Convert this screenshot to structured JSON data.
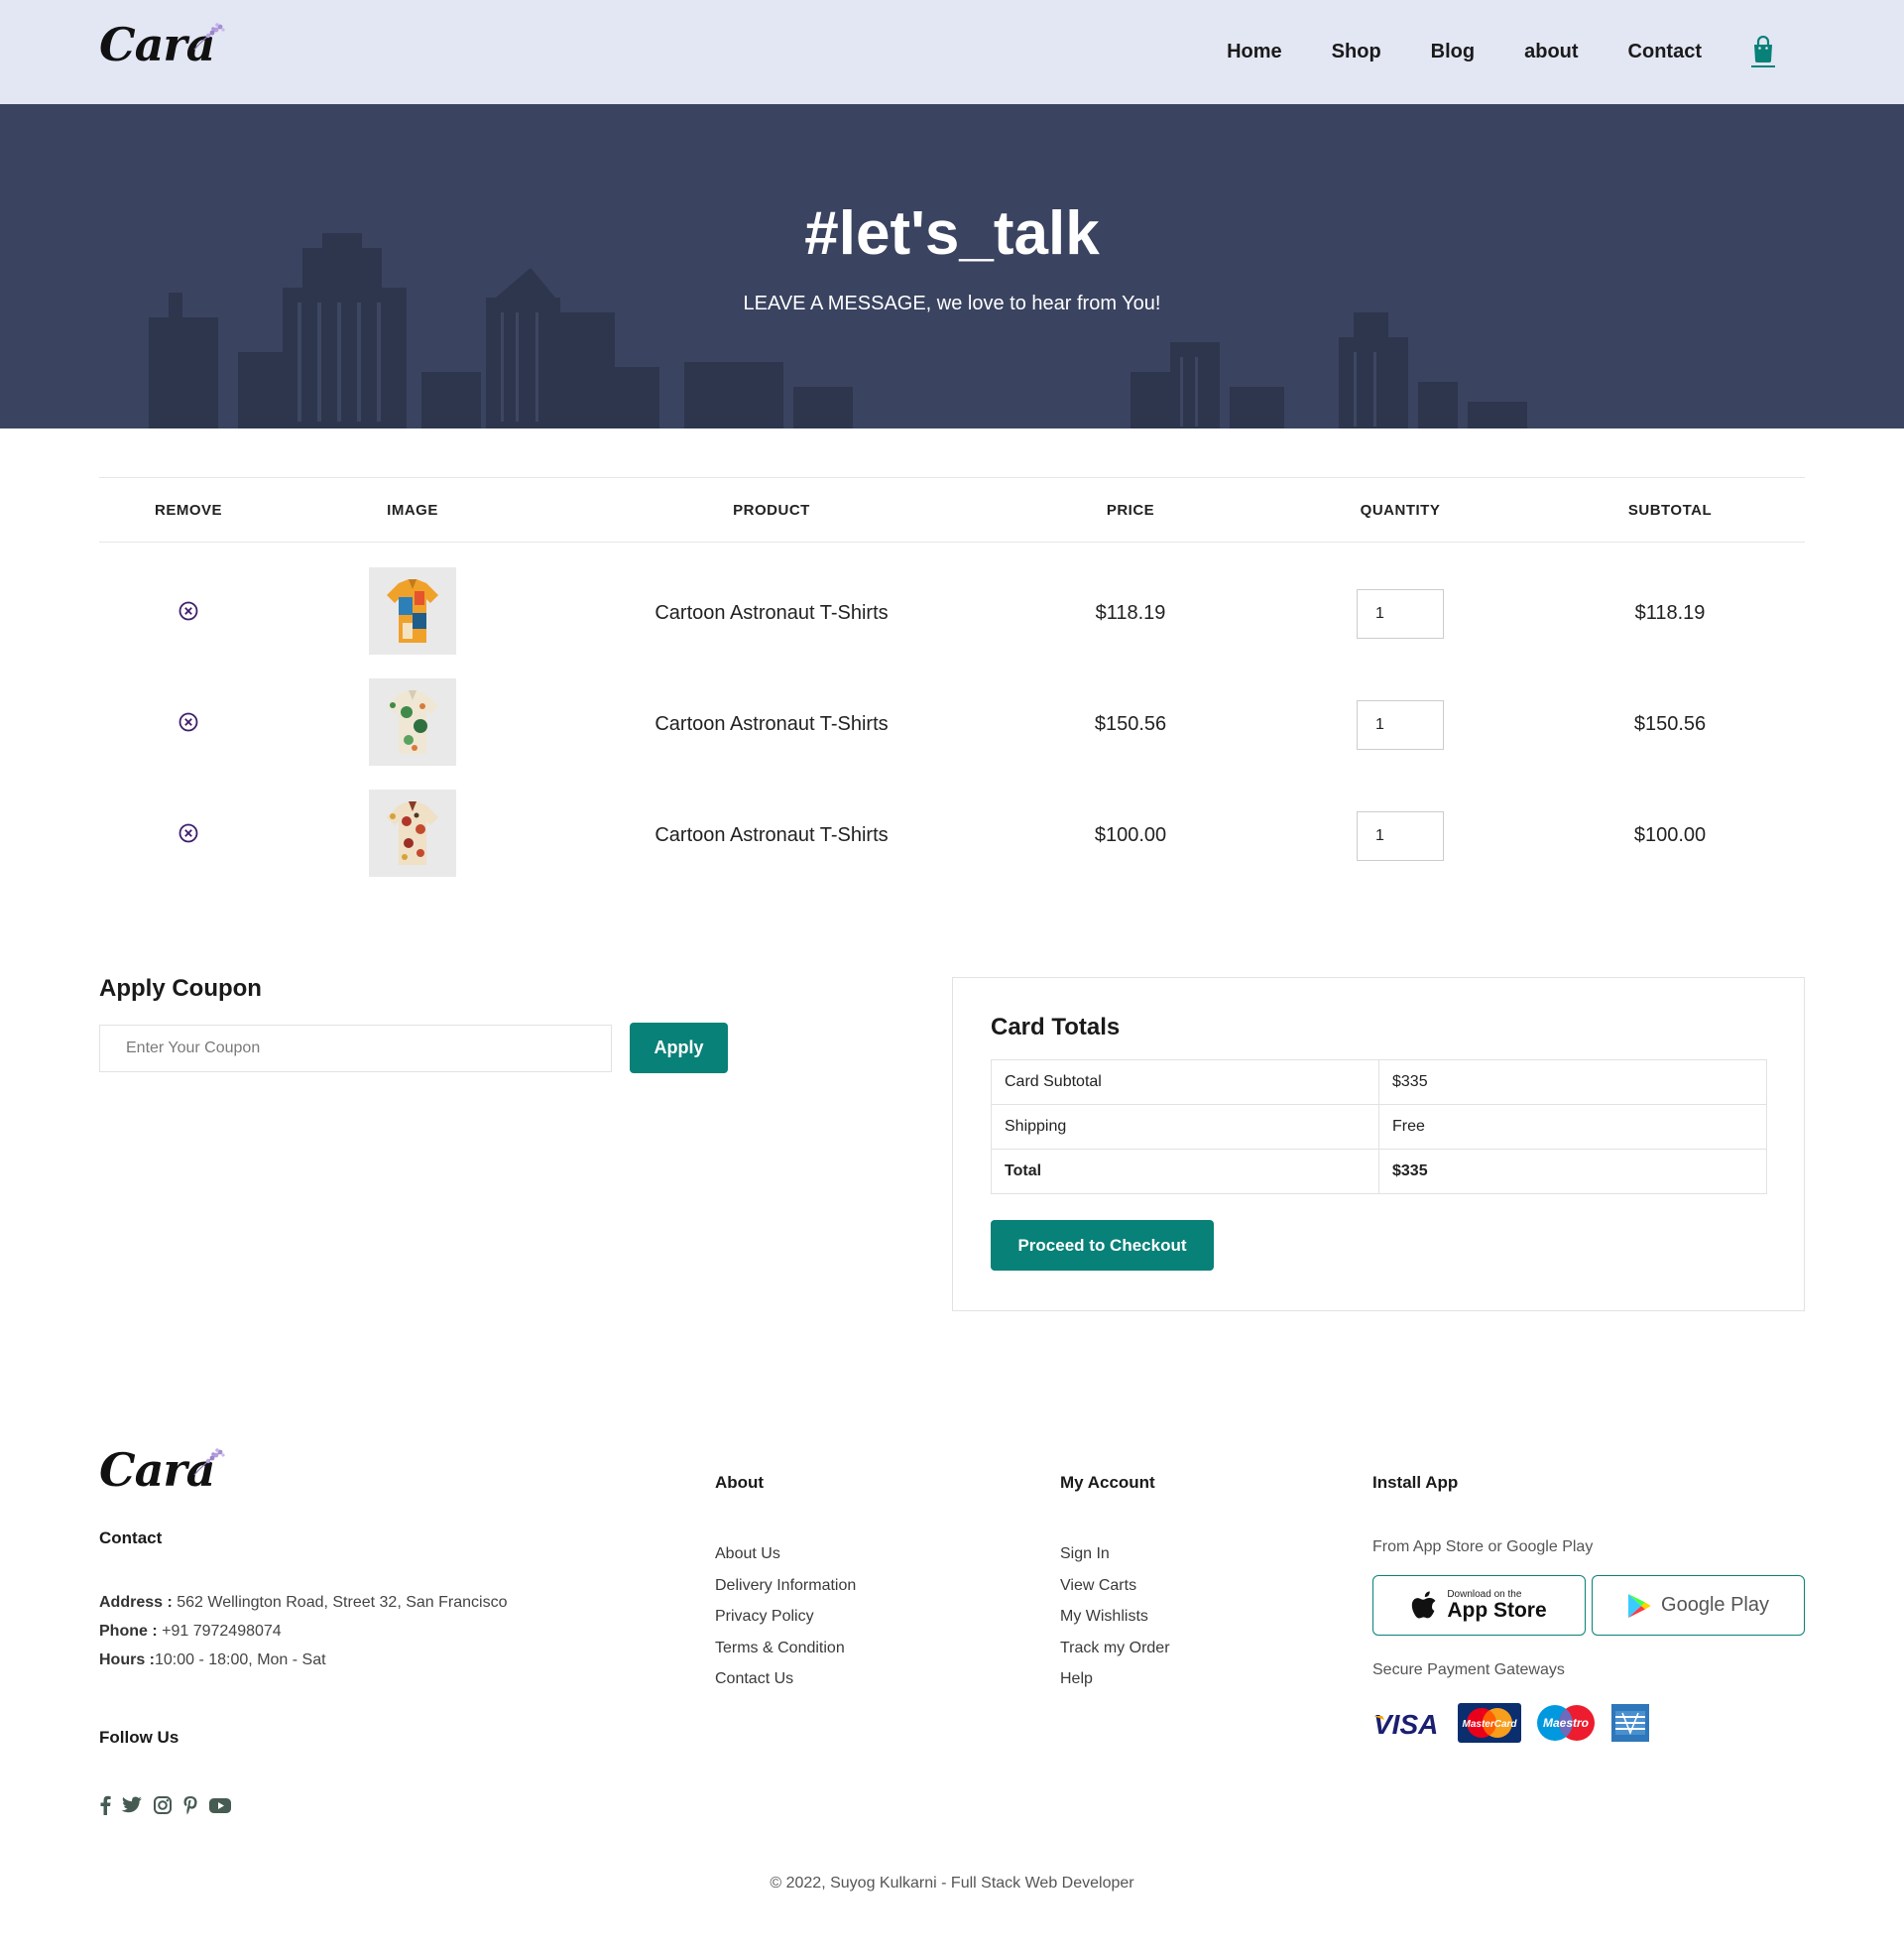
{
  "brand": {
    "logo_text": "Cara"
  },
  "nav": {
    "items": [
      {
        "label": "Home"
      },
      {
        "label": "Shop"
      },
      {
        "label": "Blog"
      },
      {
        "label": "about"
      },
      {
        "label": "Contact"
      }
    ],
    "cart_icon": "shopping-bag-icon"
  },
  "hero": {
    "title": "#let's_talk",
    "subtitle": "LEAVE A MESSAGE, we love to hear from You!"
  },
  "cart": {
    "columns": [
      "REMOVE",
      "IMAGE",
      "PRODUCT",
      "PRICE",
      "QUANTITY",
      "SUBTOTAL"
    ],
    "rows": [
      {
        "product": "Cartoon Astronaut T-Shirts",
        "price": "$118.19",
        "quantity": "1",
        "subtotal": "$118.19"
      },
      {
        "product": "Cartoon Astronaut T-Shirts",
        "price": "$150.56",
        "quantity": "1",
        "subtotal": "$150.56"
      },
      {
        "product": "Cartoon Astronaut T-Shirts",
        "price": "$100.00",
        "quantity": "1",
        "subtotal": "$100.00"
      }
    ]
  },
  "coupon": {
    "title": "Apply Coupon",
    "placeholder": "Enter Your Coupon",
    "button": "Apply"
  },
  "totals": {
    "title": "Card Totals",
    "rows": [
      {
        "label": "Card Subtotal",
        "value": "$335"
      },
      {
        "label": "Shipping",
        "value": "Free"
      },
      {
        "label": "Total",
        "value": "$335"
      }
    ],
    "checkout": "Proceed to Checkout"
  },
  "footer": {
    "contact": {
      "title": "Contact",
      "address_label": "Address :",
      "address": " 562 Wellington Road, Street 32, San Francisco",
      "phone_label": "Phone :",
      "phone": " +91 7972498074",
      "hours_label": "Hours :",
      "hours": "10:00 - 18:00, Mon - Sat",
      "follow_title": "Follow Us",
      "social_icons": [
        "facebook-icon",
        "twitter-icon",
        "instagram-icon",
        "pinterest-icon",
        "youtube-icon"
      ]
    },
    "about": {
      "title": "About",
      "links": [
        "About Us",
        "Delivery Information",
        "Privacy Policy",
        "Terms & Condition",
        "Contact Us"
      ]
    },
    "account": {
      "title": "My Account",
      "links": [
        "Sign In",
        "View Carts",
        "My Wishlists",
        "Track my Order",
        "Help"
      ]
    },
    "install": {
      "title": "Install App",
      "note": "From App Store or Google Play",
      "app_store_small": "Download on the",
      "app_store_big": "App Store",
      "google_play": "Google Play",
      "secure": "Secure Payment Gateways",
      "card_visa": "VISA",
      "card_mastercard": "MasterCard",
      "card_maestro": "Maestro"
    },
    "copyright": "© 2022, Suyog Kulkarni - Full Stack Web Developer"
  },
  "colors": {
    "accent": "#088178",
    "header_bg": "#e3e6f3",
    "hero_bg": "#3a4360",
    "remove_icon": "#3f1d6e"
  }
}
